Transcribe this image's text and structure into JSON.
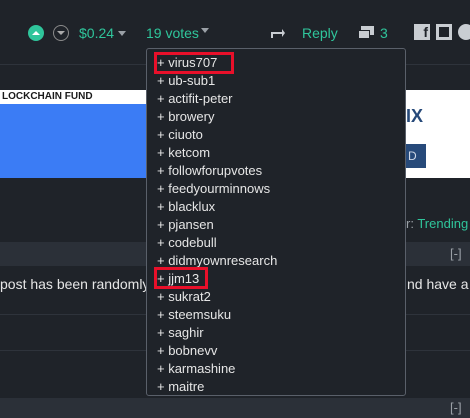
{
  "payout": "$0.24",
  "votes_label": "19 votes",
  "reply_label": "Reply",
  "comment_count": "3",
  "banner_left_text": "LOCKCHAIN FUND",
  "banner_right_text": "IX",
  "banner_right_btn": "D",
  "trending_prefix": "r:",
  "trending_label": "Trending",
  "collapse_label": "[-]",
  "body_text_left": "post has been randomly",
  "body_text_right": "nd have a",
  "voters": [
    "+ virus707",
    "+ ub-sub1",
    "+ actifit-peter",
    "+ browery",
    "+ ciuoto",
    "+ ketcom",
    "+ followforupvotes",
    "+ feedyourminnows",
    "+ blacklux",
    "+ pjansen",
    "+ codebull",
    "+ didmyownresearch",
    "+ jjm13",
    "+ sukrat2",
    "+ steemsuku",
    "+ saghir",
    "+ bobnevv",
    "+ karmashine",
    "+ maitre"
  ],
  "colors": {
    "accent": "#2fc59b",
    "highlight": "#e8102a",
    "background": "#1f2329"
  }
}
